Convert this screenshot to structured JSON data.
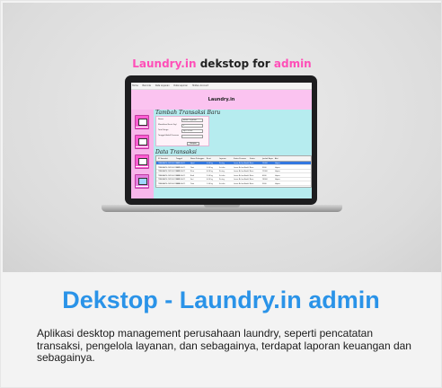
{
  "hero": {
    "title_app": "Laundry.in",
    "title_middle": " dekstop for ",
    "title_role": "admin"
  },
  "app": {
    "menu": [
      "Home",
      "Barcode",
      "Data Layanan",
      "Data Laporan",
      "Hidden Account"
    ],
    "header_title": "Laundry.in",
    "sidebar_icons": [
      "pos-icon",
      "wallet-icon",
      "report-icon",
      "laundry-icon"
    ],
    "form": {
      "title": "Tambah Transaksi Baru",
      "fields": [
        {
          "label": "Nama",
          "value": "Ambil Layanan"
        },
        {
          "label": "Masukkan Berat (kg)",
          "value": "5"
        },
        {
          "label": "Total Harga",
          "value": "Rp 15.000"
        },
        {
          "label": "Tanggal Ambil Pesanan",
          "value": ""
        }
      ],
      "submit_label": "Simpan"
    },
    "table": {
      "title": "Data Transaksi",
      "columns": [
        "ID Transaksi",
        "Tanggal",
        "Nama Pelanggan",
        "Berat",
        "Layanan",
        "Status Pesanan",
        "Status",
        "Jumlah Bayar",
        "Aksi"
      ],
      "rows": [
        [
          "TRANSAKSI-20230611-001",
          "2023-06-11",
          "Iqbal",
          "5.00 kg",
          "Kering",
          "Lunas Belum Ambil",
          "Baru",
          "15000",
          "Hapus"
        ],
        [
          "TRANSAKSI-20230611-002",
          "2023-06-11",
          "Dani",
          "3.00 kg",
          "Setrika",
          "Lunas Belum Ambil",
          "Baru",
          "9000",
          "Hapus"
        ],
        [
          "TRANSAKSI-20230611-003",
          "2023-06-11",
          "Rina",
          "4.00 kg",
          "Kering",
          "Lunas Belum Ambil",
          "Baru",
          "12000",
          "Hapus"
        ],
        [
          "TRANSAKSI-20230611-004",
          "2023-06-11",
          "Budi",
          "2.00 kg",
          "Setrika",
          "Lunas Belum Ambil",
          "Baru",
          "6000",
          "Hapus"
        ],
        [
          "TRANSAKSI-20230611-005",
          "2023-06-11",
          "Sari",
          "6.00 kg",
          "Kering",
          "Lunas Belum Ambil",
          "Baru",
          "18000",
          "Hapus"
        ],
        [
          "TRANSAKSI-20230611-006",
          "2023-06-11",
          "Tono",
          "1.00 kg",
          "Setrika",
          "Lunas Belum Ambil",
          "Baru",
          "3000",
          "Hapus"
        ]
      ]
    }
  },
  "caption": {
    "title": "Dekstop - Laundry.in admin",
    "description": "Aplikasi desktop management perusahaan laundry, seperti pencatatan transaksi, pengelola layanan, dan sebagainya, terdapat laporan keuangan dan sebagainya."
  },
  "colors": {
    "accent_pink": "#ff4fb8",
    "caption_blue": "#2a93e8",
    "app_header_pink": "#fbc3f0",
    "app_main_cyan": "#b6ecef"
  }
}
